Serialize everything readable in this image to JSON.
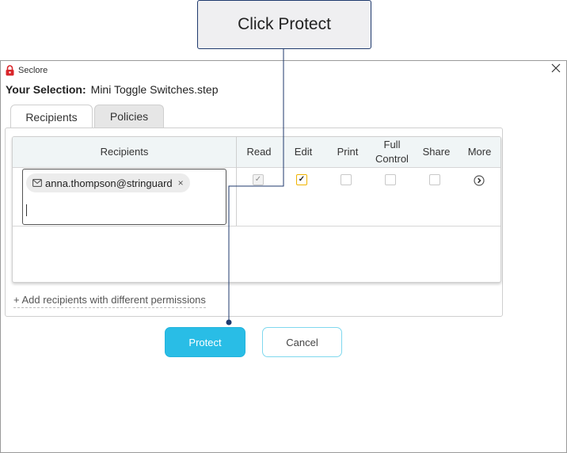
{
  "callout": {
    "text": "Click Protect"
  },
  "window": {
    "app_title": "Seclore",
    "selection_label": "Your Selection:",
    "selection_file": "Mini Toggle Switches.step",
    "tabs": [
      "Recipients",
      "Policies"
    ],
    "active_tab": "Recipients"
  },
  "grid": {
    "headers": {
      "recipients": "Recipients",
      "read": "Read",
      "edit": "Edit",
      "print": "Print",
      "full_control_line1": "Full",
      "full_control_line2": "Control",
      "share": "Share",
      "more": "More"
    },
    "row": {
      "recipient_email": "anna.thompson@stringuard",
      "remove_glyph": "×",
      "input_value": "",
      "permissions": {
        "read": true,
        "edit": true,
        "print": false,
        "full_control": false,
        "share": false
      },
      "read_disabled": true
    }
  },
  "add_link": "+ Add recipients with different permissions",
  "buttons": {
    "protect": "Protect",
    "cancel": "Cancel"
  },
  "icons": {
    "app": "lock-icon",
    "close": "close-icon",
    "chip": "mail-icon",
    "more": "chevron-right-circle-icon"
  },
  "colors": {
    "accent": "#29bde6",
    "callout_border": "#1f3a6e",
    "edit_checkbox": "#f0b400",
    "header_bg": "#f0f5f6"
  }
}
